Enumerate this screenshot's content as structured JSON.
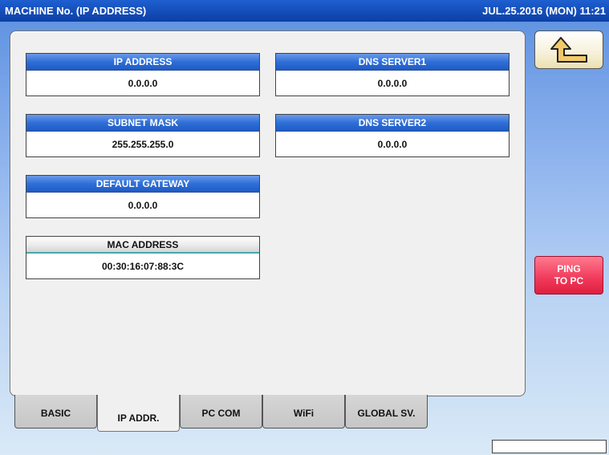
{
  "titlebar": {
    "title": "MACHINE No. (IP ADDRESS)",
    "clock": "JUL.25.2016 (MON)  11:21"
  },
  "fields": {
    "ip_address": {
      "label": "IP ADDRESS",
      "value": "0.0.0.0"
    },
    "subnet_mask": {
      "label": "SUBNET MASK",
      "value": "255.255.255.0"
    },
    "default_gateway": {
      "label": "DEFAULT GATEWAY",
      "value": "0.0.0.0"
    },
    "mac_address": {
      "label": "MAC ADDRESS",
      "value": "00:30:16:07:88:3C"
    },
    "dns_server1": {
      "label": "DNS SERVER1",
      "value": "0.0.0.0"
    },
    "dns_server2": {
      "label": "DNS SERVER2",
      "value": "0.0.0.0"
    }
  },
  "buttons": {
    "back_icon": "return-arrow-icon",
    "ping_line1": "PING",
    "ping_line2": "TO PC"
  },
  "tabs": [
    {
      "label": "BASIC"
    },
    {
      "label": "IP ADDR.",
      "active": true
    },
    {
      "label": "PC COM"
    },
    {
      "label": "WiFi"
    },
    {
      "label": "GLOBAL SV."
    }
  ],
  "status_box": "",
  "colors": {
    "title_bar": "#0b3fa5",
    "field_header": "#2f6fd8",
    "ping_button": "#f0385a",
    "back_button": "#f6f0d8"
  }
}
